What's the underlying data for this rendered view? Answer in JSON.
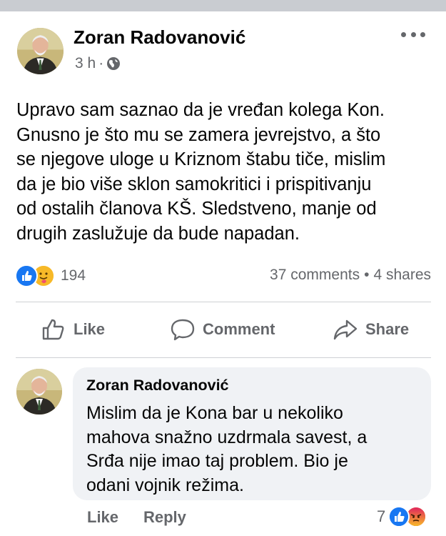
{
  "post": {
    "author": "Zoran Radovanović",
    "time": "3 h",
    "separator": "·",
    "audience_icon": "globe-icon",
    "more_icon": "more-options-icon",
    "text_lines": [
      "Upravo sam saznao da je vređan kolega Kon.",
      "Gnusno je što mu se zamera jevrejstvo, a što",
      "se njegove uloge u Kriznom štabu tiče, mislim",
      "da je bio više sklon samokritici i prispitivanju",
      "od ostalih članova KŠ. Sledstveno, manje od",
      "drugih zaslužuje da bude napadan."
    ],
    "reaction_icons": [
      "like-reaction-icon",
      "care-reaction-icon"
    ],
    "reaction_count": "194",
    "comments": "37 comments",
    "dot": "•",
    "shares": "4 shares"
  },
  "actions": {
    "like": "Like",
    "comment": "Comment",
    "share": "Share"
  },
  "comment": {
    "author": "Zoran Radovanović",
    "text_lines": [
      "Mislim da je Kona bar u nekoliko",
      "mahova snažno uzdrmala savest, a",
      "Srđa nije imao taj problem. Bio je",
      "odani vojnik režima."
    ],
    "like": "Like",
    "reply": "Reply",
    "reaction_count": "7",
    "reaction_icons": [
      "like-reaction-icon",
      "angry-reaction-icon"
    ]
  },
  "colors": {
    "text": "#050505",
    "secondary": "#65676b",
    "like_blue": "#1877f2",
    "bubble": "#f0f2f5"
  }
}
